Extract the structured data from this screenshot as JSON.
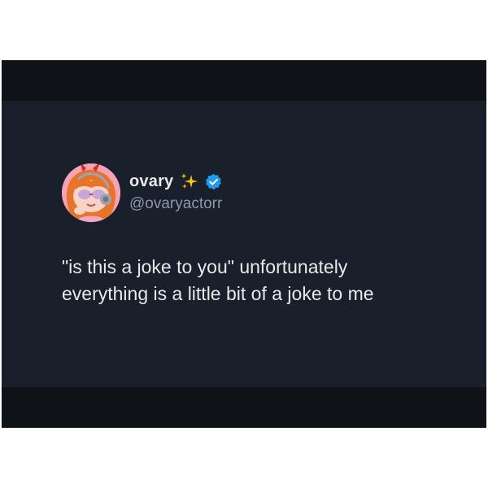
{
  "tweet": {
    "display_name": "ovary",
    "handle": "@ovaryactorr",
    "text_lines": [
      "\"is this a joke to you\" unfortunately",
      "everything is a little bit of a joke to me"
    ]
  },
  "icons": {
    "name_emoji": "sparkles-icon",
    "badge": "verified-badge-icon",
    "avatar": "avatar-image"
  },
  "colors": {
    "background": "#1a202b",
    "bars": "#0f1317",
    "text": "#e7e9ea",
    "handle": "#8b98a5",
    "verified": "#1d9bf0",
    "sparkles": "#f5c518"
  }
}
